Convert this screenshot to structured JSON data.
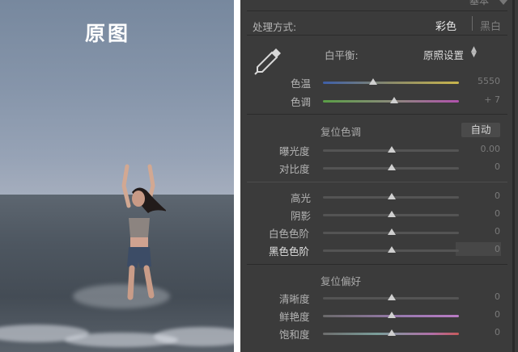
{
  "photo": {
    "title": "原图"
  },
  "panel": {
    "header_fragment": "基本",
    "treatment": {
      "label": "处理方式:",
      "options": [
        "彩色",
        "黑白"
      ],
      "selected": "彩色"
    },
    "white_balance": {
      "label": "白平衡:",
      "value": "原照设置",
      "sliders": [
        {
          "id": "temp",
          "label": "色温",
          "value": "5550",
          "position": 0.38
        },
        {
          "id": "tint",
          "label": "色调",
          "value": "+ 7",
          "position": 0.52
        }
      ]
    },
    "tone": {
      "reset_label": "复位色调",
      "auto_label": "自动",
      "sliders": [
        {
          "id": "exposure",
          "label": "曝光度",
          "value": "0.00",
          "position": 0.5
        },
        {
          "id": "contrast",
          "label": "对比度",
          "value": "0",
          "position": 0.5
        },
        {
          "id": "highlights",
          "label": "高光",
          "value": "0",
          "position": 0.5
        },
        {
          "id": "shadows",
          "label": "阴影",
          "value": "0",
          "position": 0.5
        },
        {
          "id": "whites",
          "label": "白色色阶",
          "value": "0",
          "position": 0.5
        },
        {
          "id": "blacks",
          "label": "黑色色阶",
          "value": "0",
          "position": 0.5
        }
      ]
    },
    "presence": {
      "reset_label": "复位偏好",
      "sliders": [
        {
          "id": "clarity",
          "label": "清晰度",
          "value": "0",
          "position": 0.5
        },
        {
          "id": "vibrance",
          "label": "鲜艳度",
          "value": "0",
          "position": 0.5
        },
        {
          "id": "saturation",
          "label": "饱和度",
          "value": "0",
          "position": 0.5
        }
      ]
    }
  }
}
